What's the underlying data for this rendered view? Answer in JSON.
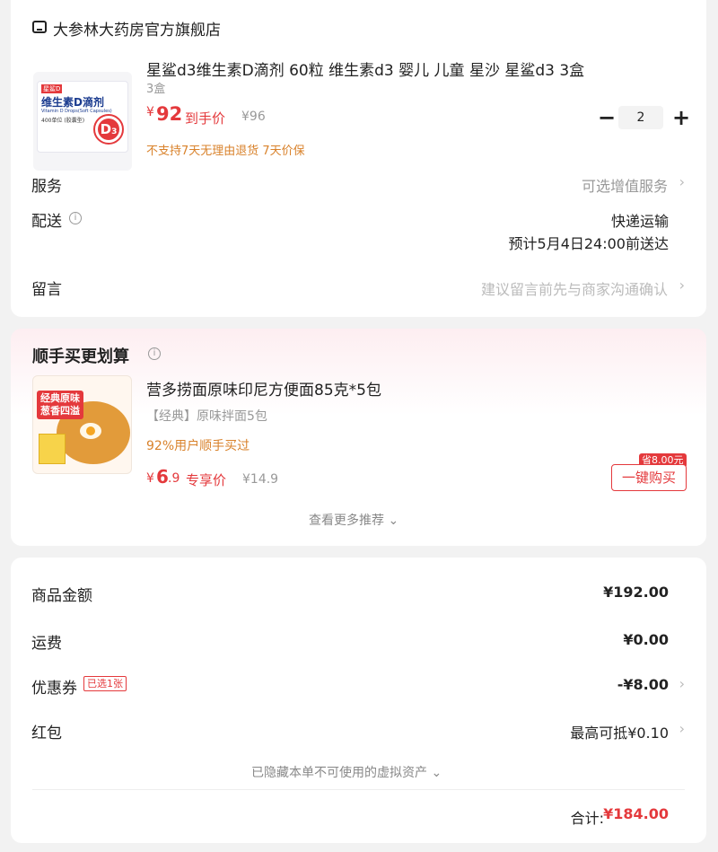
{
  "shop": {
    "store_name": "大参林大药房官方旗舰店",
    "product": {
      "name": "星鲨d3维生素D滴剂  60粒 维生素d3 婴儿 儿童 星沙 星鲨d3 3盒",
      "spec": "3盒",
      "price_symbol": "¥",
      "price": "92",
      "price_tag": "到手价",
      "original_price": "¥96",
      "quantity": "2",
      "minus": "−",
      "plus": "+",
      "policy": "不支持7天无理由退货  7天价保",
      "box_brand": "星鲨D",
      "box_title": "维生素D滴剂",
      "box_subtitle": "Vitamin D Drops(Soft Capsules)",
      "box_dose": "400单位 (胶囊型)",
      "box_d": "D",
      "box_d_sub": "3"
    },
    "service": {
      "label": "服务",
      "value": "可选增值服务"
    },
    "delivery": {
      "label": "配送",
      "method": "快递运输",
      "eta": "预计5月4日24:00前送达"
    },
    "message": {
      "label": "留言",
      "placeholder": "建议留言前先与商家沟通确认"
    }
  },
  "addon": {
    "title": "顺手买更划算",
    "product": {
      "name": "营多捞面原味印尼方便面85克*5包",
      "spec": "【经典】原味拌面5包",
      "social": "92%用户顺手买过",
      "price_symbol": "¥",
      "price_int": "6",
      "price_dec": ".9",
      "price_tag": "专享价",
      "original_price": "¥14.9",
      "save_badge": "省8.00元",
      "buy_button": "一键购买",
      "img_text_1": "经典原味",
      "img_text_2": "葱香四溢"
    },
    "more": "查看更多推荐"
  },
  "summary": {
    "rows": [
      {
        "label": "商品金额",
        "value": "¥192.00"
      },
      {
        "label": "运费",
        "value": "¥0.00"
      },
      {
        "label": "优惠券",
        "tag": "已选1张",
        "value": "-¥8.00"
      },
      {
        "label": "红包",
        "value": "最高可抵¥0.10"
      }
    ],
    "hidden_assets": "已隐藏本单不可使用的虚拟资产",
    "total_label": "合计:",
    "total_value": "¥184.00"
  },
  "glyphs": {
    "chevron": "›",
    "chevron_down": "⌄",
    "info": "i"
  },
  "colors": {
    "accent": "#e4393c",
    "orange": "#d9822b"
  },
  "icons": [
    "store-icon",
    "info-icon",
    "chevron-right-icon",
    "chevron-down-icon"
  ]
}
